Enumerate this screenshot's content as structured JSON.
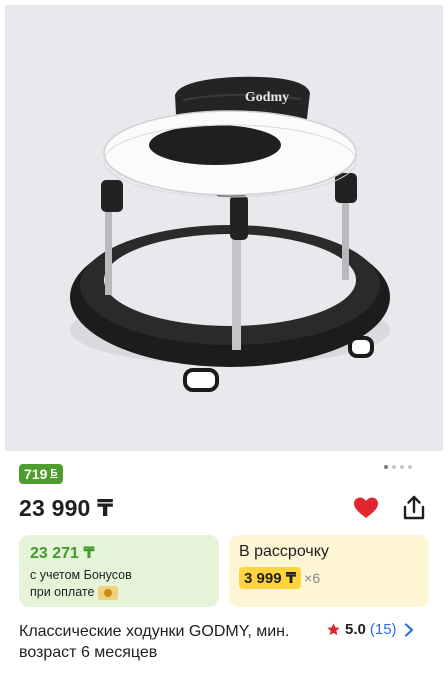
{
  "product": {
    "image_alt": "Godmy",
    "brand_logo_text": "Godmy",
    "bonus_badge": "719",
    "bonus_badge_symbol": "Б",
    "price": "23 990 ₸",
    "title": "Классические ходунки GODMY, мин. возраст 6 месяцев",
    "favorite_color": "#e0262e"
  },
  "bonus_card": {
    "amount": "23 271 ₸",
    "line1": "с учетом Бонусов",
    "line2": "при оплате"
  },
  "installment_card": {
    "title": "В рассрочку",
    "monthly": "3 999 ₸",
    "multiplier": "×6"
  },
  "rating": {
    "score": "5.0",
    "count": "(15)"
  },
  "gallery": {
    "dots": 4,
    "active_index": 0
  },
  "icons": [
    "heart-icon",
    "share-icon",
    "star-icon",
    "chevron-right-icon",
    "kaspi-icon"
  ],
  "colors": {
    "accent_green": "#4f9d2d",
    "installment_yellow": "#fcd53c",
    "link_blue": "#2b6ee8",
    "star_red": "#e0262e"
  }
}
